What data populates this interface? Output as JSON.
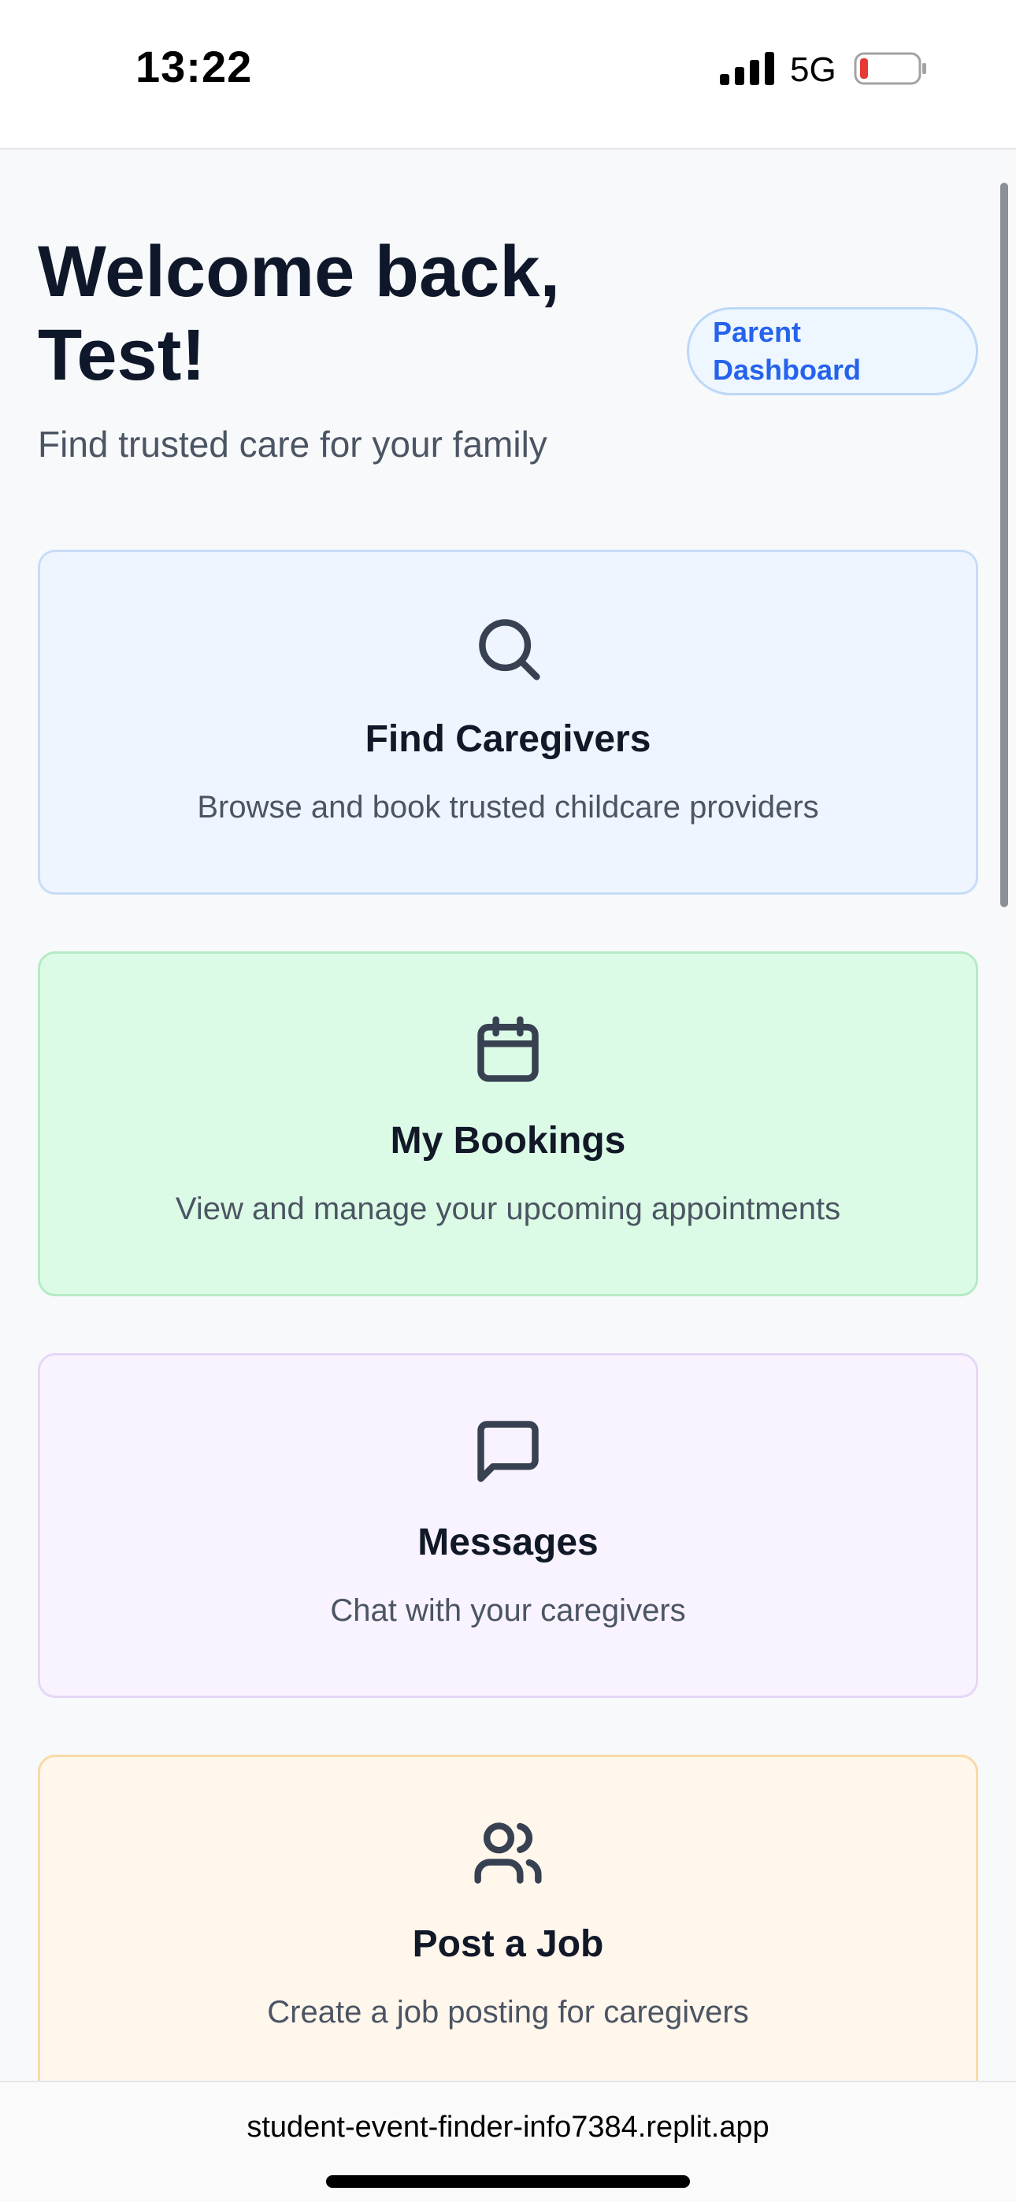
{
  "status_bar": {
    "time": "13:22",
    "network": "5G",
    "signal_icon": "signal-bars-icon",
    "battery_icon": "battery-low-icon",
    "battery_color": "#e53935"
  },
  "header": {
    "welcome_title": "Welcome back, Test!",
    "role_badge": "Parent Dashboard",
    "subtitle": "Find trusted care for your family"
  },
  "cards": [
    {
      "icon": "search-icon",
      "title": "Find Caregivers",
      "description": "Browse and book trusted childcare providers",
      "background": "#eef5ff"
    },
    {
      "icon": "calendar-icon",
      "title": "My Bookings",
      "description": "View and manage your upcoming appointments",
      "background": "#dcfbe6"
    },
    {
      "icon": "message-icon",
      "title": "Messages",
      "description": "Chat with your caregivers",
      "background": "#f8f3fe"
    },
    {
      "icon": "users-icon",
      "title": "Post a Job",
      "description": "Create a job posting for caregivers",
      "background": "#fff6ec"
    }
  ],
  "browser": {
    "url": "student-event-finder-info7384.replit.app"
  },
  "colors": {
    "accent": "#2563eb",
    "text_primary": "#0f172a",
    "text_secondary": "#4b5563"
  }
}
